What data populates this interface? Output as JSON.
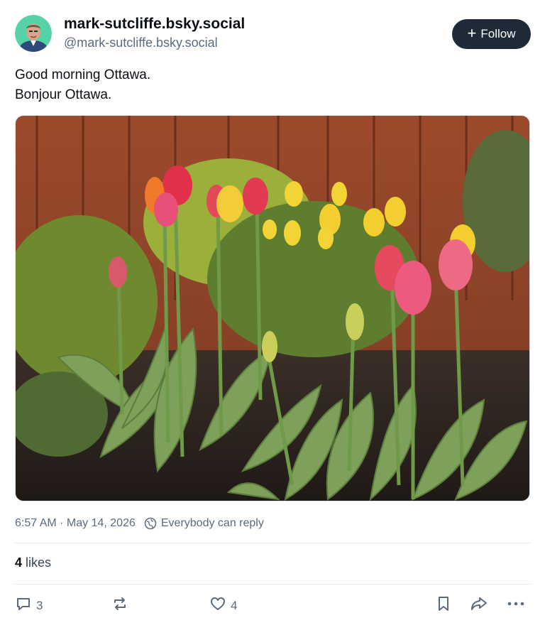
{
  "author": {
    "display_name": "mark-sutcliffe.bsky.social",
    "handle": "@mark-sutcliffe.bsky.social"
  },
  "follow_button": {
    "label": "Follow",
    "icon": "plus-icon"
  },
  "post": {
    "lines": [
      "Good morning Ottawa.",
      "Bonjour Ottawa."
    ],
    "image_subject": "tulips"
  },
  "meta": {
    "timestamp": "6:57 AM · May 14, 2026",
    "reply_setting": "Everybody can reply",
    "reply_icon": "globe-icon"
  },
  "likes": {
    "count": "4",
    "label": "likes"
  },
  "actions": {
    "reply_count": "3",
    "repost_count": "",
    "like_count": "4"
  },
  "colors": {
    "follow_bg": "#1e2a38",
    "muted_text": "#5b6b7d",
    "icon": "#5b6b7d"
  }
}
